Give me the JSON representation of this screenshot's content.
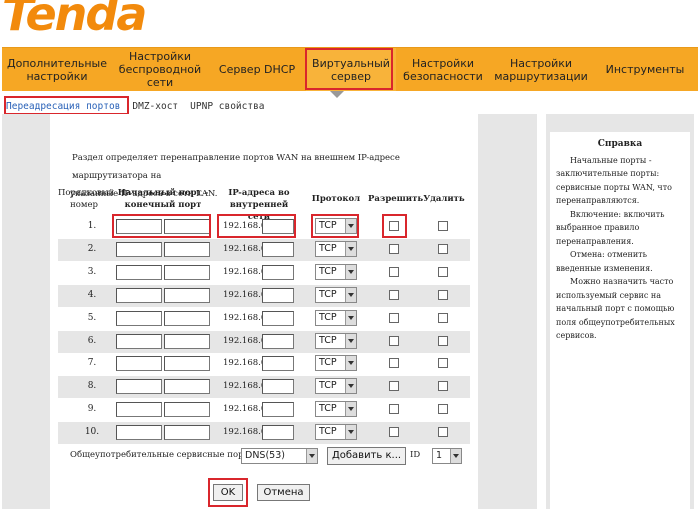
{
  "logo": "Tenda",
  "nav": {
    "items": [
      {
        "label": "Дополнительные настройки"
      },
      {
        "label": "Настройки беспроводной сети"
      },
      {
        "label": "Сервер DHCP"
      },
      {
        "label": "Виртуальный сервер"
      },
      {
        "label": "Настройки безопасности"
      },
      {
        "label": "Настройки маршрутизации"
      },
      {
        "label": "Инструменты"
      }
    ]
  },
  "subnav": {
    "items": [
      {
        "label": "Переадресация портов"
      },
      {
        "label": "DMZ-хост"
      },
      {
        "label": "UPNP свойства"
      }
    ]
  },
  "main": {
    "description_1": "Раздел определяет перенаправление портов WAN на внешнем IP-адресе маршрутизатора на",
    "description_2": "указанные IP-адреса в сети LAN.",
    "headers": {
      "num_1": "Порядковый",
      "num_2": "номер",
      "ports_1": "Начальный порт -",
      "ports_2": "конечный порт",
      "ip_1": "IP-адреса во",
      "ip_2": "внутренней сети",
      "protocol": "Протокол",
      "enable": "Разрешить",
      "delete": "Удалить"
    },
    "rows": [
      {
        "num": "1.",
        "ip_prefix": "192.168.0.",
        "protocol": "TCP"
      },
      {
        "num": "2.",
        "ip_prefix": "192.168.0.",
        "protocol": "TCP"
      },
      {
        "num": "3.",
        "ip_prefix": "192.168.0.",
        "protocol": "TCP"
      },
      {
        "num": "4.",
        "ip_prefix": "192.168.0.",
        "protocol": "TCP"
      },
      {
        "num": "5.",
        "ip_prefix": "192.168.0.",
        "protocol": "TCP"
      },
      {
        "num": "6.",
        "ip_prefix": "192.168.0.",
        "protocol": "TCP"
      },
      {
        "num": "7.",
        "ip_prefix": "192.168.0.",
        "protocol": "TCP"
      },
      {
        "num": "8.",
        "ip_prefix": "192.168.0.",
        "protocol": "TCP"
      },
      {
        "num": "9.",
        "ip_prefix": "192.168.0.",
        "protocol": "TCP"
      },
      {
        "num": "10.",
        "ip_prefix": "192.168.0.",
        "protocol": "TCP"
      }
    ],
    "common_ports_label": "Общеупотребительные сервисные порты:",
    "common_ports_value": "DNS(53)",
    "add_button": "Добавить к...",
    "id_label": "ID",
    "id_value": "1",
    "ok_button": "OK",
    "cancel_button": "Отмена"
  },
  "help": {
    "title": "Справка",
    "p1": "Начальные порты - заключительные порты: сервисные порты WAN, что перенаправляются.",
    "p2": "Включение: включить выбранное правило перенаправления.",
    "p3": "Отмена: отменить введенные изменения.",
    "p4": "Можно назначить часто используемый сервис на начальный порт с помощью поля общеупотребительных сервисов."
  },
  "colors": {
    "nav_bg": "#f6a724",
    "logo": "#f28a0c",
    "highlight": "#d9262c",
    "active_sub": "#2a62b8"
  }
}
